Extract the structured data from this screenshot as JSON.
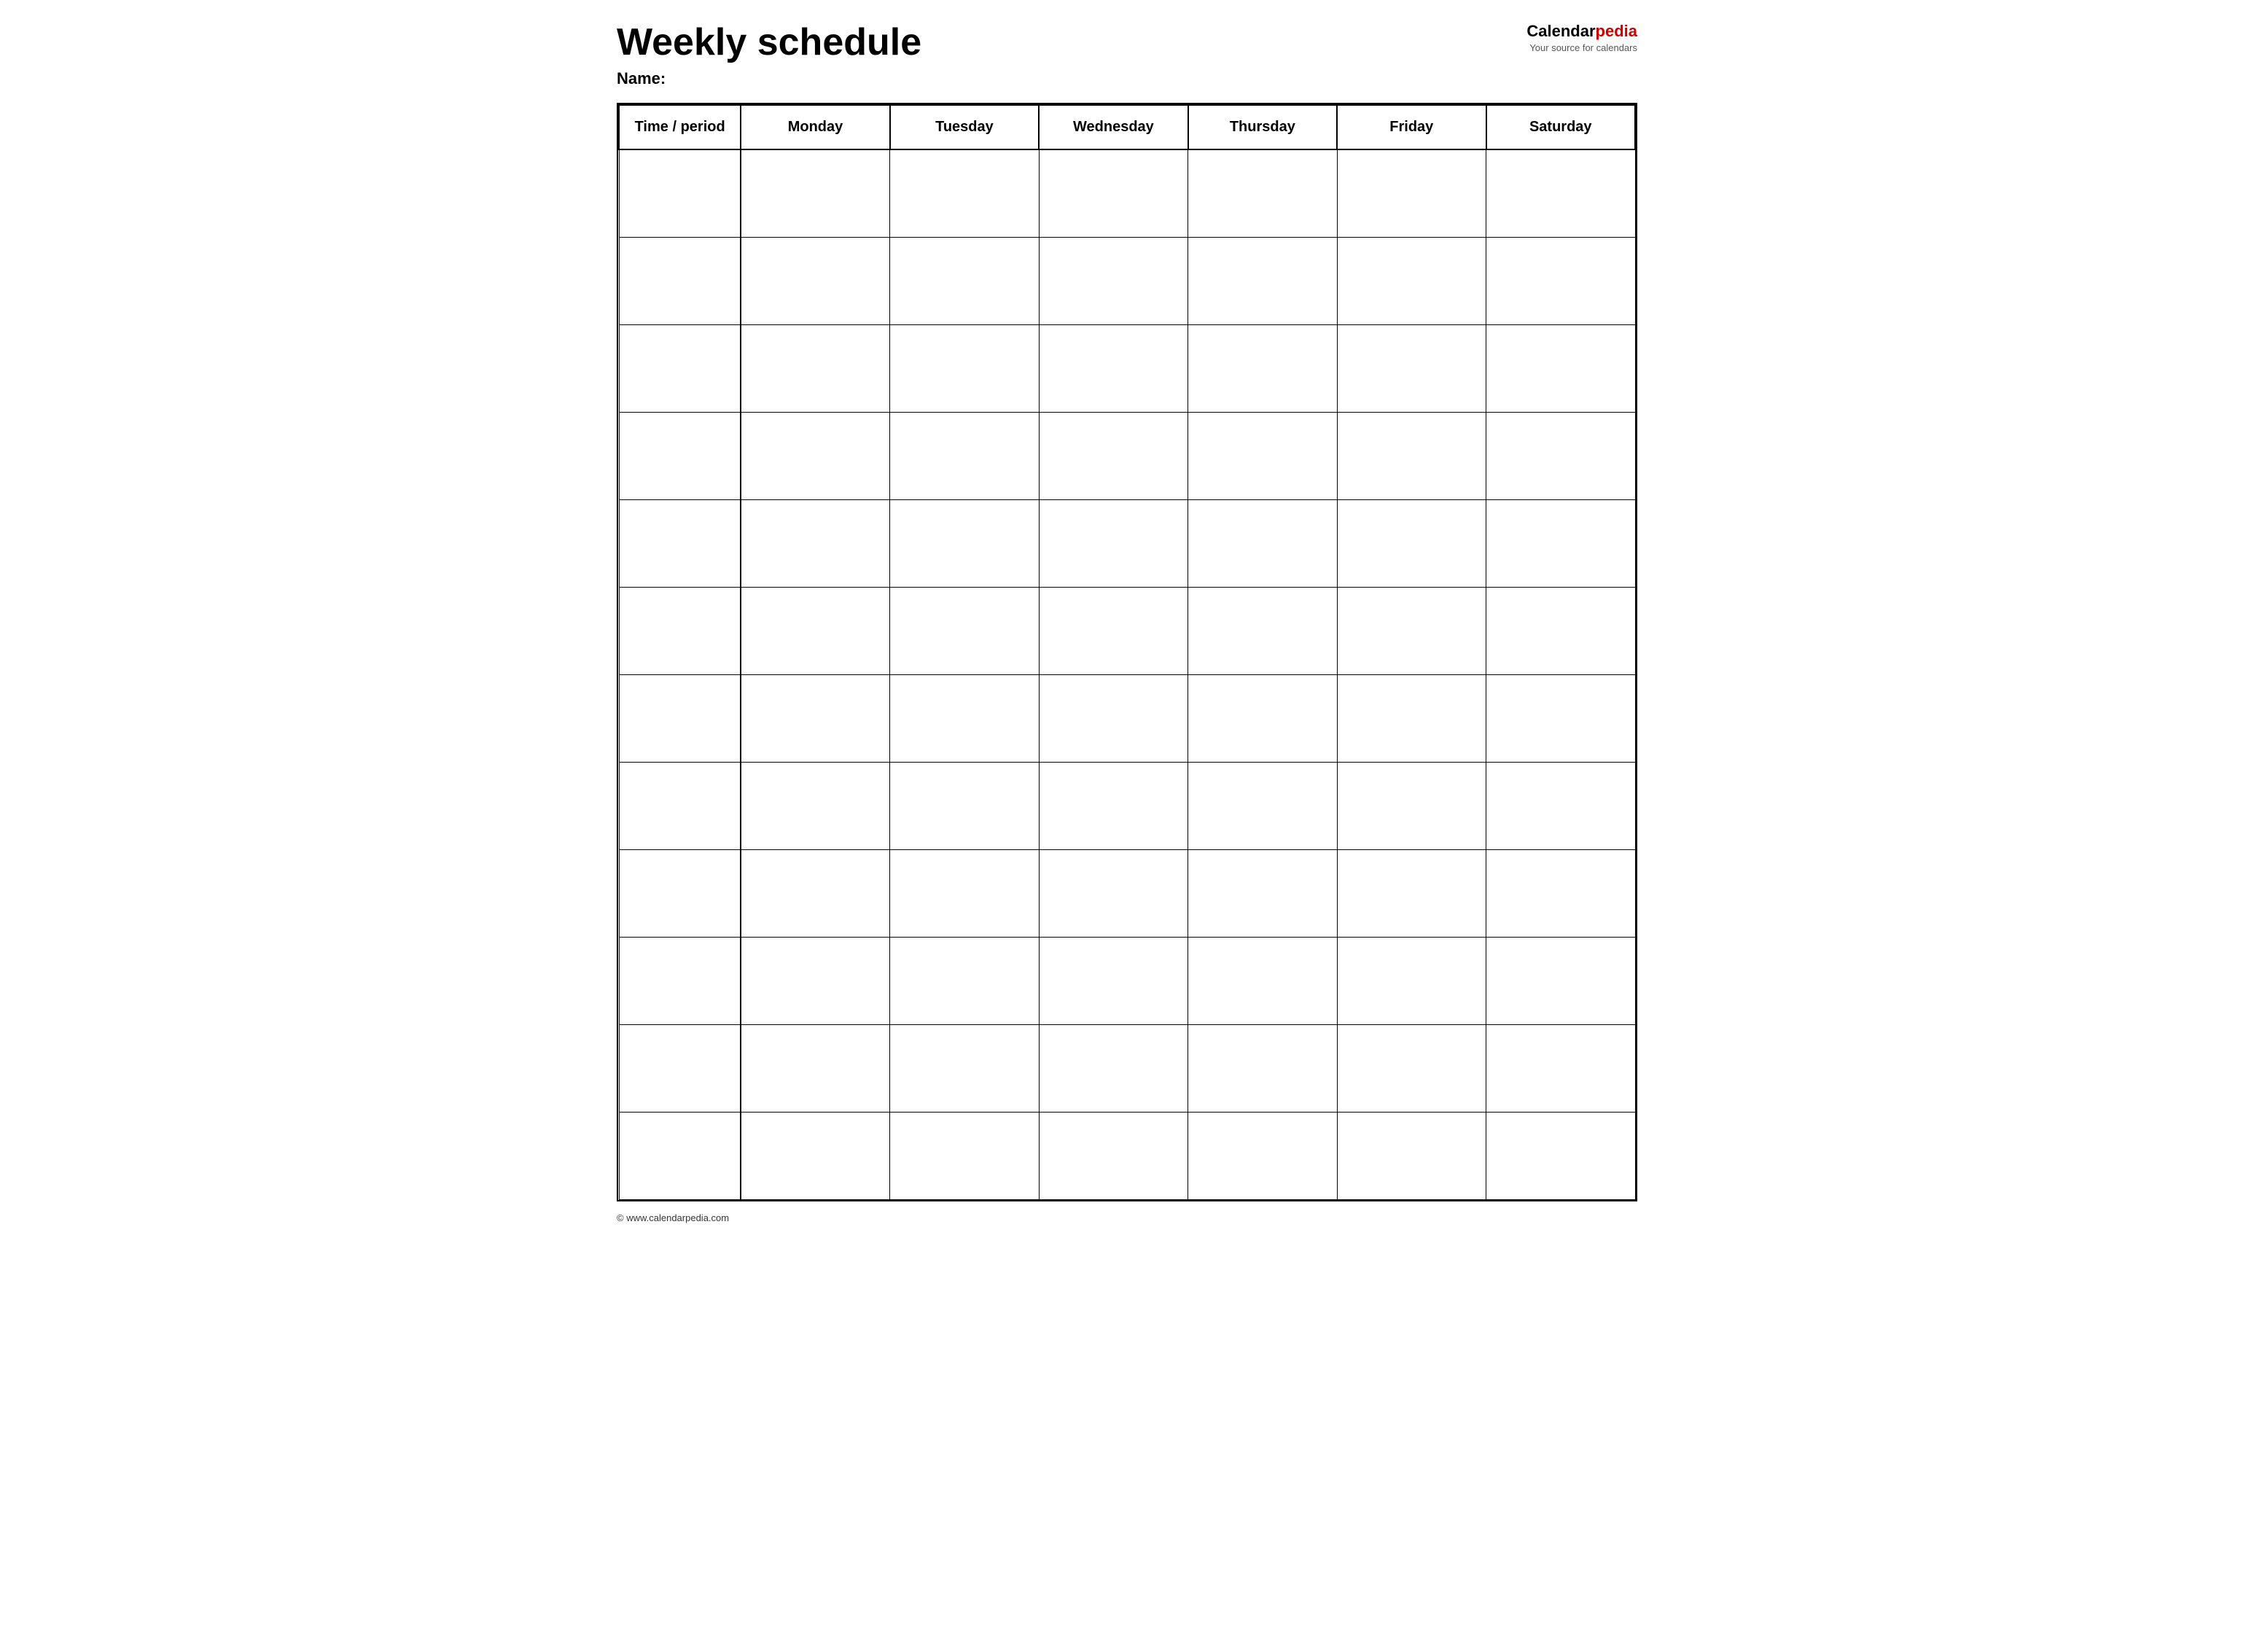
{
  "page": {
    "title": "Weekly schedule",
    "name_label": "Name:",
    "footer_text": "© www.calendarpedia.com"
  },
  "logo": {
    "calendar_part": "Calendar",
    "pedia_part": "pedia",
    "subtitle": "Your source for calendars"
  },
  "table": {
    "columns": [
      {
        "id": "time",
        "label": "Time / period"
      },
      {
        "id": "monday",
        "label": "Monday"
      },
      {
        "id": "tuesday",
        "label": "Tuesday"
      },
      {
        "id": "wednesday",
        "label": "Wednesday"
      },
      {
        "id": "thursday",
        "label": "Thursday"
      },
      {
        "id": "friday",
        "label": "Friday"
      },
      {
        "id": "saturday",
        "label": "Saturday"
      }
    ],
    "row_count": 12
  }
}
